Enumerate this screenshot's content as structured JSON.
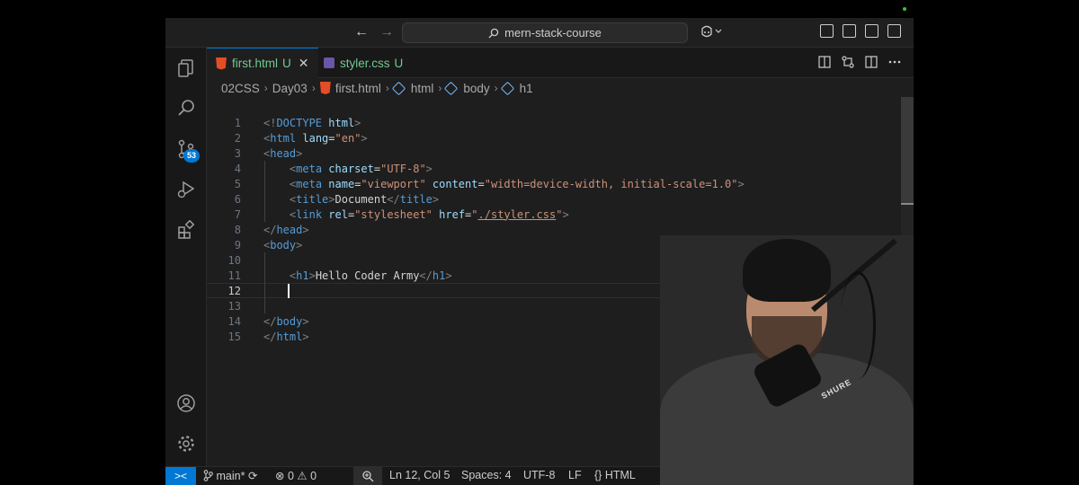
{
  "titlebar": {
    "search_text": "mern-stack-course",
    "back_icon": "arrow-left-icon",
    "forward_icon": "arrow-right-icon",
    "copilot_icon": "copilot-icon"
  },
  "activity": {
    "source_control_badge": "53"
  },
  "tabs": [
    {
      "label": "first.html",
      "modified": "U",
      "icon": "html5-icon",
      "active": true
    },
    {
      "label": "styler.css",
      "modified": "U",
      "icon": "css3-icon",
      "active": false
    }
  ],
  "breadcrumb": {
    "items": [
      "02CSS",
      "Day03",
      "first.html",
      "html",
      "body",
      "h1"
    ]
  },
  "editor": {
    "line_numbers": [
      "1",
      "2",
      "3",
      "4",
      "5",
      "6",
      "7",
      "8",
      "9",
      "10",
      "11",
      "12",
      "13",
      "14",
      "15"
    ],
    "current_line": 12,
    "lines": [
      [
        {
          "t": "<!",
          "c": "punc"
        },
        {
          "t": "DOCTYPE",
          "c": "tag"
        },
        {
          "t": " ",
          "c": "text"
        },
        {
          "t": "html",
          "c": "attr"
        },
        {
          "t": ">",
          "c": "punc"
        }
      ],
      [
        {
          "t": "<",
          "c": "punc"
        },
        {
          "t": "html",
          "c": "tag"
        },
        {
          "t": " ",
          "c": "text"
        },
        {
          "t": "lang",
          "c": "attr"
        },
        {
          "t": "=",
          "c": "text"
        },
        {
          "t": "\"en\"",
          "c": "str"
        },
        {
          "t": ">",
          "c": "punc"
        }
      ],
      [
        {
          "t": "<",
          "c": "punc"
        },
        {
          "t": "head",
          "c": "tag"
        },
        {
          "t": ">",
          "c": "punc"
        }
      ],
      [
        {
          "t": "    ",
          "c": "text"
        },
        {
          "t": "<",
          "c": "punc"
        },
        {
          "t": "meta",
          "c": "tag"
        },
        {
          "t": " ",
          "c": "text"
        },
        {
          "t": "charset",
          "c": "attr"
        },
        {
          "t": "=",
          "c": "text"
        },
        {
          "t": "\"UTF-8\"",
          "c": "str"
        },
        {
          "t": ">",
          "c": "punc"
        }
      ],
      [
        {
          "t": "    ",
          "c": "text"
        },
        {
          "t": "<",
          "c": "punc"
        },
        {
          "t": "meta",
          "c": "tag"
        },
        {
          "t": " ",
          "c": "text"
        },
        {
          "t": "name",
          "c": "attr"
        },
        {
          "t": "=",
          "c": "text"
        },
        {
          "t": "\"viewport\"",
          "c": "str"
        },
        {
          "t": " ",
          "c": "text"
        },
        {
          "t": "content",
          "c": "attr"
        },
        {
          "t": "=",
          "c": "text"
        },
        {
          "t": "\"width=device-width, initial-scale=1.0\"",
          "c": "str"
        },
        {
          "t": ">",
          "c": "punc"
        }
      ],
      [
        {
          "t": "    ",
          "c": "text"
        },
        {
          "t": "<",
          "c": "punc"
        },
        {
          "t": "title",
          "c": "tag"
        },
        {
          "t": ">",
          "c": "punc"
        },
        {
          "t": "Document",
          "c": "text"
        },
        {
          "t": "</",
          "c": "punc"
        },
        {
          "t": "title",
          "c": "tag"
        },
        {
          "t": ">",
          "c": "punc"
        }
      ],
      [
        {
          "t": "    ",
          "c": "text"
        },
        {
          "t": "<",
          "c": "punc"
        },
        {
          "t": "link",
          "c": "tag"
        },
        {
          "t": " ",
          "c": "text"
        },
        {
          "t": "rel",
          "c": "attr"
        },
        {
          "t": "=",
          "c": "text"
        },
        {
          "t": "\"stylesheet\"",
          "c": "str"
        },
        {
          "t": " ",
          "c": "text"
        },
        {
          "t": "href",
          "c": "attr"
        },
        {
          "t": "=",
          "c": "text"
        },
        {
          "t": "\"",
          "c": "str"
        },
        {
          "t": "./styler.css",
          "c": "link"
        },
        {
          "t": "\"",
          "c": "str"
        },
        {
          "t": ">",
          "c": "punc"
        }
      ],
      [
        {
          "t": "</",
          "c": "punc"
        },
        {
          "t": "head",
          "c": "tag"
        },
        {
          "t": ">",
          "c": "punc"
        }
      ],
      [
        {
          "t": "<",
          "c": "punc"
        },
        {
          "t": "body",
          "c": "tag"
        },
        {
          "t": ">",
          "c": "punc"
        }
      ],
      [],
      [
        {
          "t": "    ",
          "c": "text"
        },
        {
          "t": "<",
          "c": "punc"
        },
        {
          "t": "h1",
          "c": "tag"
        },
        {
          "t": ">",
          "c": "punc"
        },
        {
          "t": "Hello Coder Army",
          "c": "text"
        },
        {
          "t": "</",
          "c": "punc"
        },
        {
          "t": "h1",
          "c": "tag"
        },
        {
          "t": ">",
          "c": "punc"
        }
      ],
      [],
      [],
      [
        {
          "t": "</",
          "c": "punc"
        },
        {
          "t": "body",
          "c": "tag"
        },
        {
          "t": ">",
          "c": "punc"
        }
      ],
      [
        {
          "t": "</",
          "c": "punc"
        },
        {
          "t": "html",
          "c": "tag"
        },
        {
          "t": ">",
          "c": "punc"
        }
      ]
    ]
  },
  "statusbar": {
    "branch": "main*",
    "errors": "0",
    "warnings": "0",
    "position": "Ln 12, Col 5",
    "spaces": "Spaces: 4",
    "encoding": "UTF-8",
    "eol": "LF",
    "language": "HTML"
  },
  "webcam": {
    "mic_label": "SHURE"
  },
  "colors": {
    "accent": "#0078d4",
    "modified": "#73c991",
    "tag": "#569cd6",
    "attr": "#9cdcfe",
    "string": "#ce9178"
  }
}
